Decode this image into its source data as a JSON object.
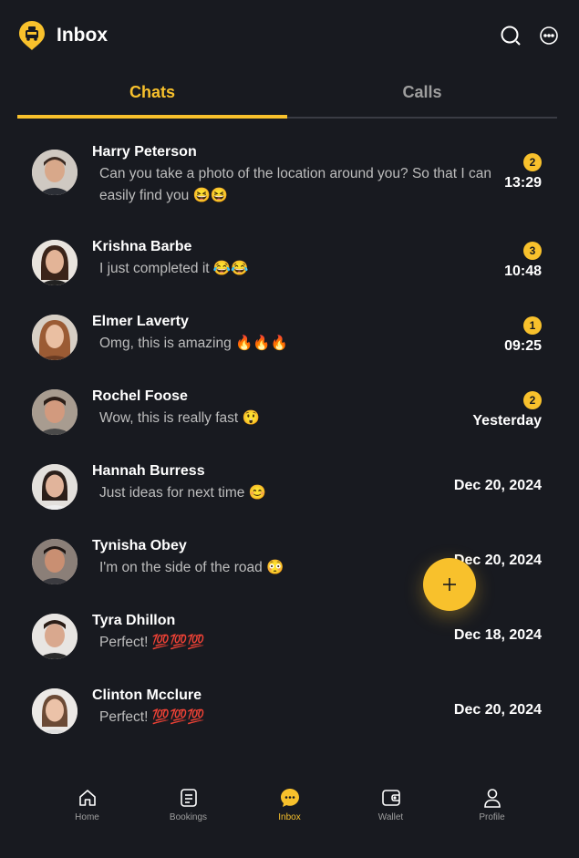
{
  "header": {
    "title": "Inbox"
  },
  "tabs": [
    {
      "label": "Chats",
      "active": true
    },
    {
      "label": "Calls",
      "active": false
    }
  ],
  "chats": [
    {
      "name": "Harry Peterson",
      "message": "Can you take a photo of the location around you? So that I can easily find you 😆😆",
      "time": "13:29",
      "badge": "2"
    },
    {
      "name": "Krishna Barbe",
      "message": "I just completed it 😂😂",
      "time": "10:48",
      "badge": "3"
    },
    {
      "name": "Elmer Laverty",
      "message": "Omg, this is amazing 🔥🔥🔥",
      "time": "09:25",
      "badge": "1"
    },
    {
      "name": "Rochel Foose",
      "message": "Wow, this is really fast 😲",
      "time": "Yesterday",
      "badge": "2"
    },
    {
      "name": "Hannah Burress",
      "message": "Just ideas for next time 😊",
      "time": "Dec 20, 2024",
      "badge": ""
    },
    {
      "name": "Tynisha Obey",
      "message": "I'm on the side of the road 😳",
      "time": "Dec 20, 2024",
      "badge": ""
    },
    {
      "name": "Tyra Dhillon",
      "message": "Perfect! 💯💯💯",
      "time": "Dec 18, 2024",
      "badge": ""
    },
    {
      "name": "Clinton Mcclure",
      "message": "Perfect! 💯💯💯",
      "time": "Dec 20, 2024",
      "badge": ""
    }
  ],
  "fab": {
    "label": "+"
  },
  "nav": [
    {
      "label": "Home",
      "icon": "home-icon",
      "active": false
    },
    {
      "label": "Bookings",
      "icon": "bookings-icon",
      "active": false
    },
    {
      "label": "Inbox",
      "icon": "inbox-icon",
      "active": true
    },
    {
      "label": "Wallet",
      "icon": "wallet-icon",
      "active": false
    },
    {
      "label": "Profile",
      "icon": "profile-icon",
      "active": false
    }
  ],
  "colors": {
    "accent": "#f8c12c",
    "background": "#181a20",
    "muted": "#9e9e9e"
  }
}
